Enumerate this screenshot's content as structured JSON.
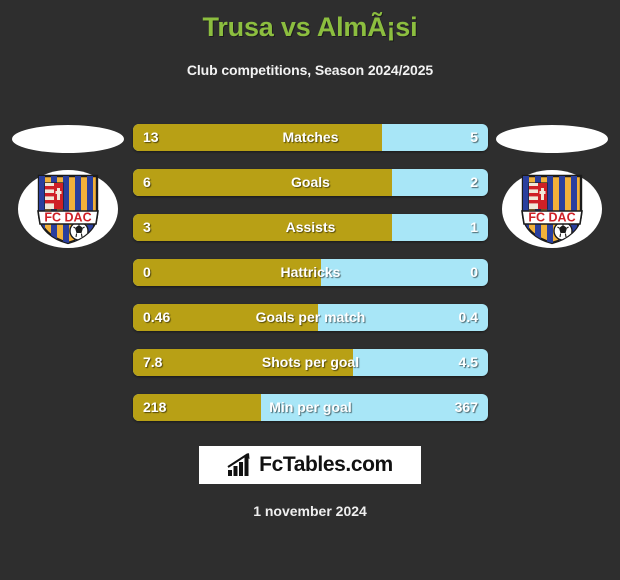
{
  "header": {
    "title": "Trusa vs AlmÃ¡si",
    "subtitle": "Club competitions, Season 2024/2025"
  },
  "teams": {
    "home": {
      "crest_name": "fc-dac-crest",
      "crest_text": "FC DAC"
    },
    "away": {
      "crest_name": "fc-dac-crest",
      "crest_text": "FC DAC"
    }
  },
  "colors": {
    "background": "#2e2e2e",
    "title": "#8cbe3f",
    "home_bar": "#b8a015",
    "away_bar": "#a8e6f7",
    "text": "#ffffff"
  },
  "chart_data": {
    "type": "bar",
    "title": "Trusa vs AlmÃ¡si",
    "subtitle": "Club competitions, Season 2024/2025",
    "orientation": "horizontal-diverging",
    "series": [
      {
        "name": "Trusa",
        "color": "#b8a015",
        "values": [
          13,
          6,
          3,
          0,
          0.46,
          7.8,
          218
        ]
      },
      {
        "name": "AlmÃ¡si",
        "color": "#a8e6f7",
        "values": [
          5,
          2,
          1,
          0,
          0.4,
          4.5,
          367
        ]
      }
    ],
    "categories": [
      "Matches",
      "Goals",
      "Assists",
      "Hattricks",
      "Goals per match",
      "Shots per goal",
      "Min per goal"
    ],
    "rows": [
      {
        "label": "Matches",
        "home": "13",
        "away": "5",
        "home_pct": 70
      },
      {
        "label": "Goals",
        "home": "6",
        "away": "2",
        "home_pct": 73
      },
      {
        "label": "Assists",
        "home": "3",
        "away": "1",
        "home_pct": 73
      },
      {
        "label": "Hattricks",
        "home": "0",
        "away": "0",
        "home_pct": 53
      },
      {
        "label": "Goals per match",
        "home": "0.46",
        "away": "0.4",
        "home_pct": 52
      },
      {
        "label": "Shots per goal",
        "home": "7.8",
        "away": "4.5",
        "home_pct": 62
      },
      {
        "label": "Min per goal",
        "home": "218",
        "away": "367",
        "home_pct": 36
      }
    ],
    "grid": false,
    "legend": "none"
  },
  "footer": {
    "logo_text": "FcTables.com",
    "logo_icon": "bar-chart-growth-icon",
    "date": "1 november 2024"
  }
}
